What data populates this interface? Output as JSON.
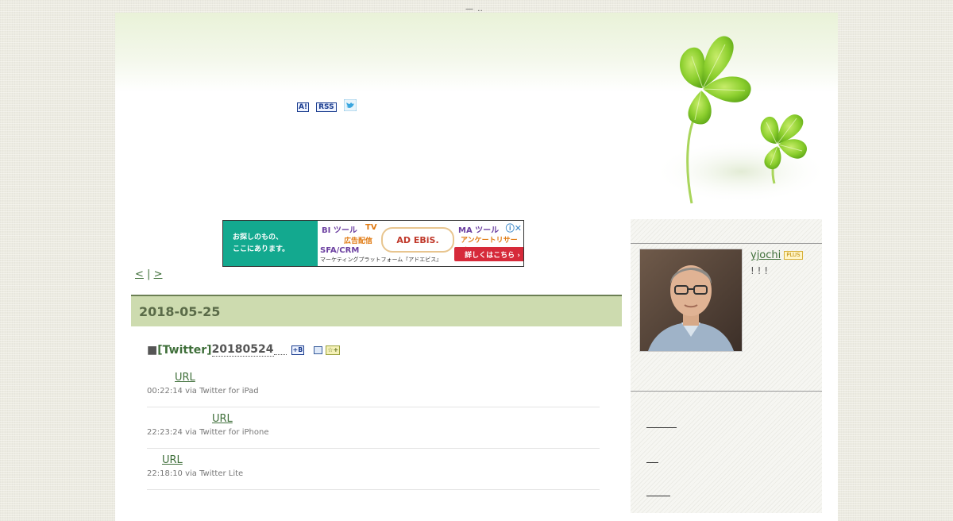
{
  "top_marks": "— ‥",
  "header": {
    "icons": [
      {
        "label": "A!",
        "icon": "antenna-icon"
      },
      {
        "label": "RSS",
        "icon": "rss-icon"
      },
      {
        "label": "",
        "icon": "twitter-bird-icon"
      }
    ]
  },
  "ad": {
    "left_line1": "お探しのもの、",
    "left_line2": "ここにあります。",
    "bi_tool": "BI ツール",
    "tv": "TV",
    "ad_delivery": "広告配信",
    "sfa_crm": "SFA/CRM",
    "platform": "マーケティングプラットフォーム『アドエビス』",
    "brand": "AD EBiS.",
    "ma_tool": "MA ツール",
    "survey": "アンケートリサーチ",
    "cta": "詳しくはこちら ›",
    "close": "ⓘ✕"
  },
  "pager": {
    "prev": "<",
    "sep": "|",
    "next": ">"
  },
  "day": {
    "date": "2018-05-25"
  },
  "entry": {
    "bullet": "■",
    "category": "[Twitter]",
    "date_code": "20180524"
  },
  "tweets": [
    {
      "link": "URL",
      "meta": "00:22:14 via Twitter for iPad"
    },
    {
      "link": "URL",
      "meta": "22:23:24 via Twitter for iPhone"
    },
    {
      "link": "URL",
      "meta": "22:18:10 via Twitter Lite"
    }
  ],
  "profile": {
    "name": "yjochi",
    "badge": "PLUS",
    "text": "! ! !"
  },
  "colors": {
    "day_bar": "#cddbaf",
    "link": "#3f6f3a",
    "ad_green": "#13a98f",
    "ad_red": "#d62a3a"
  }
}
